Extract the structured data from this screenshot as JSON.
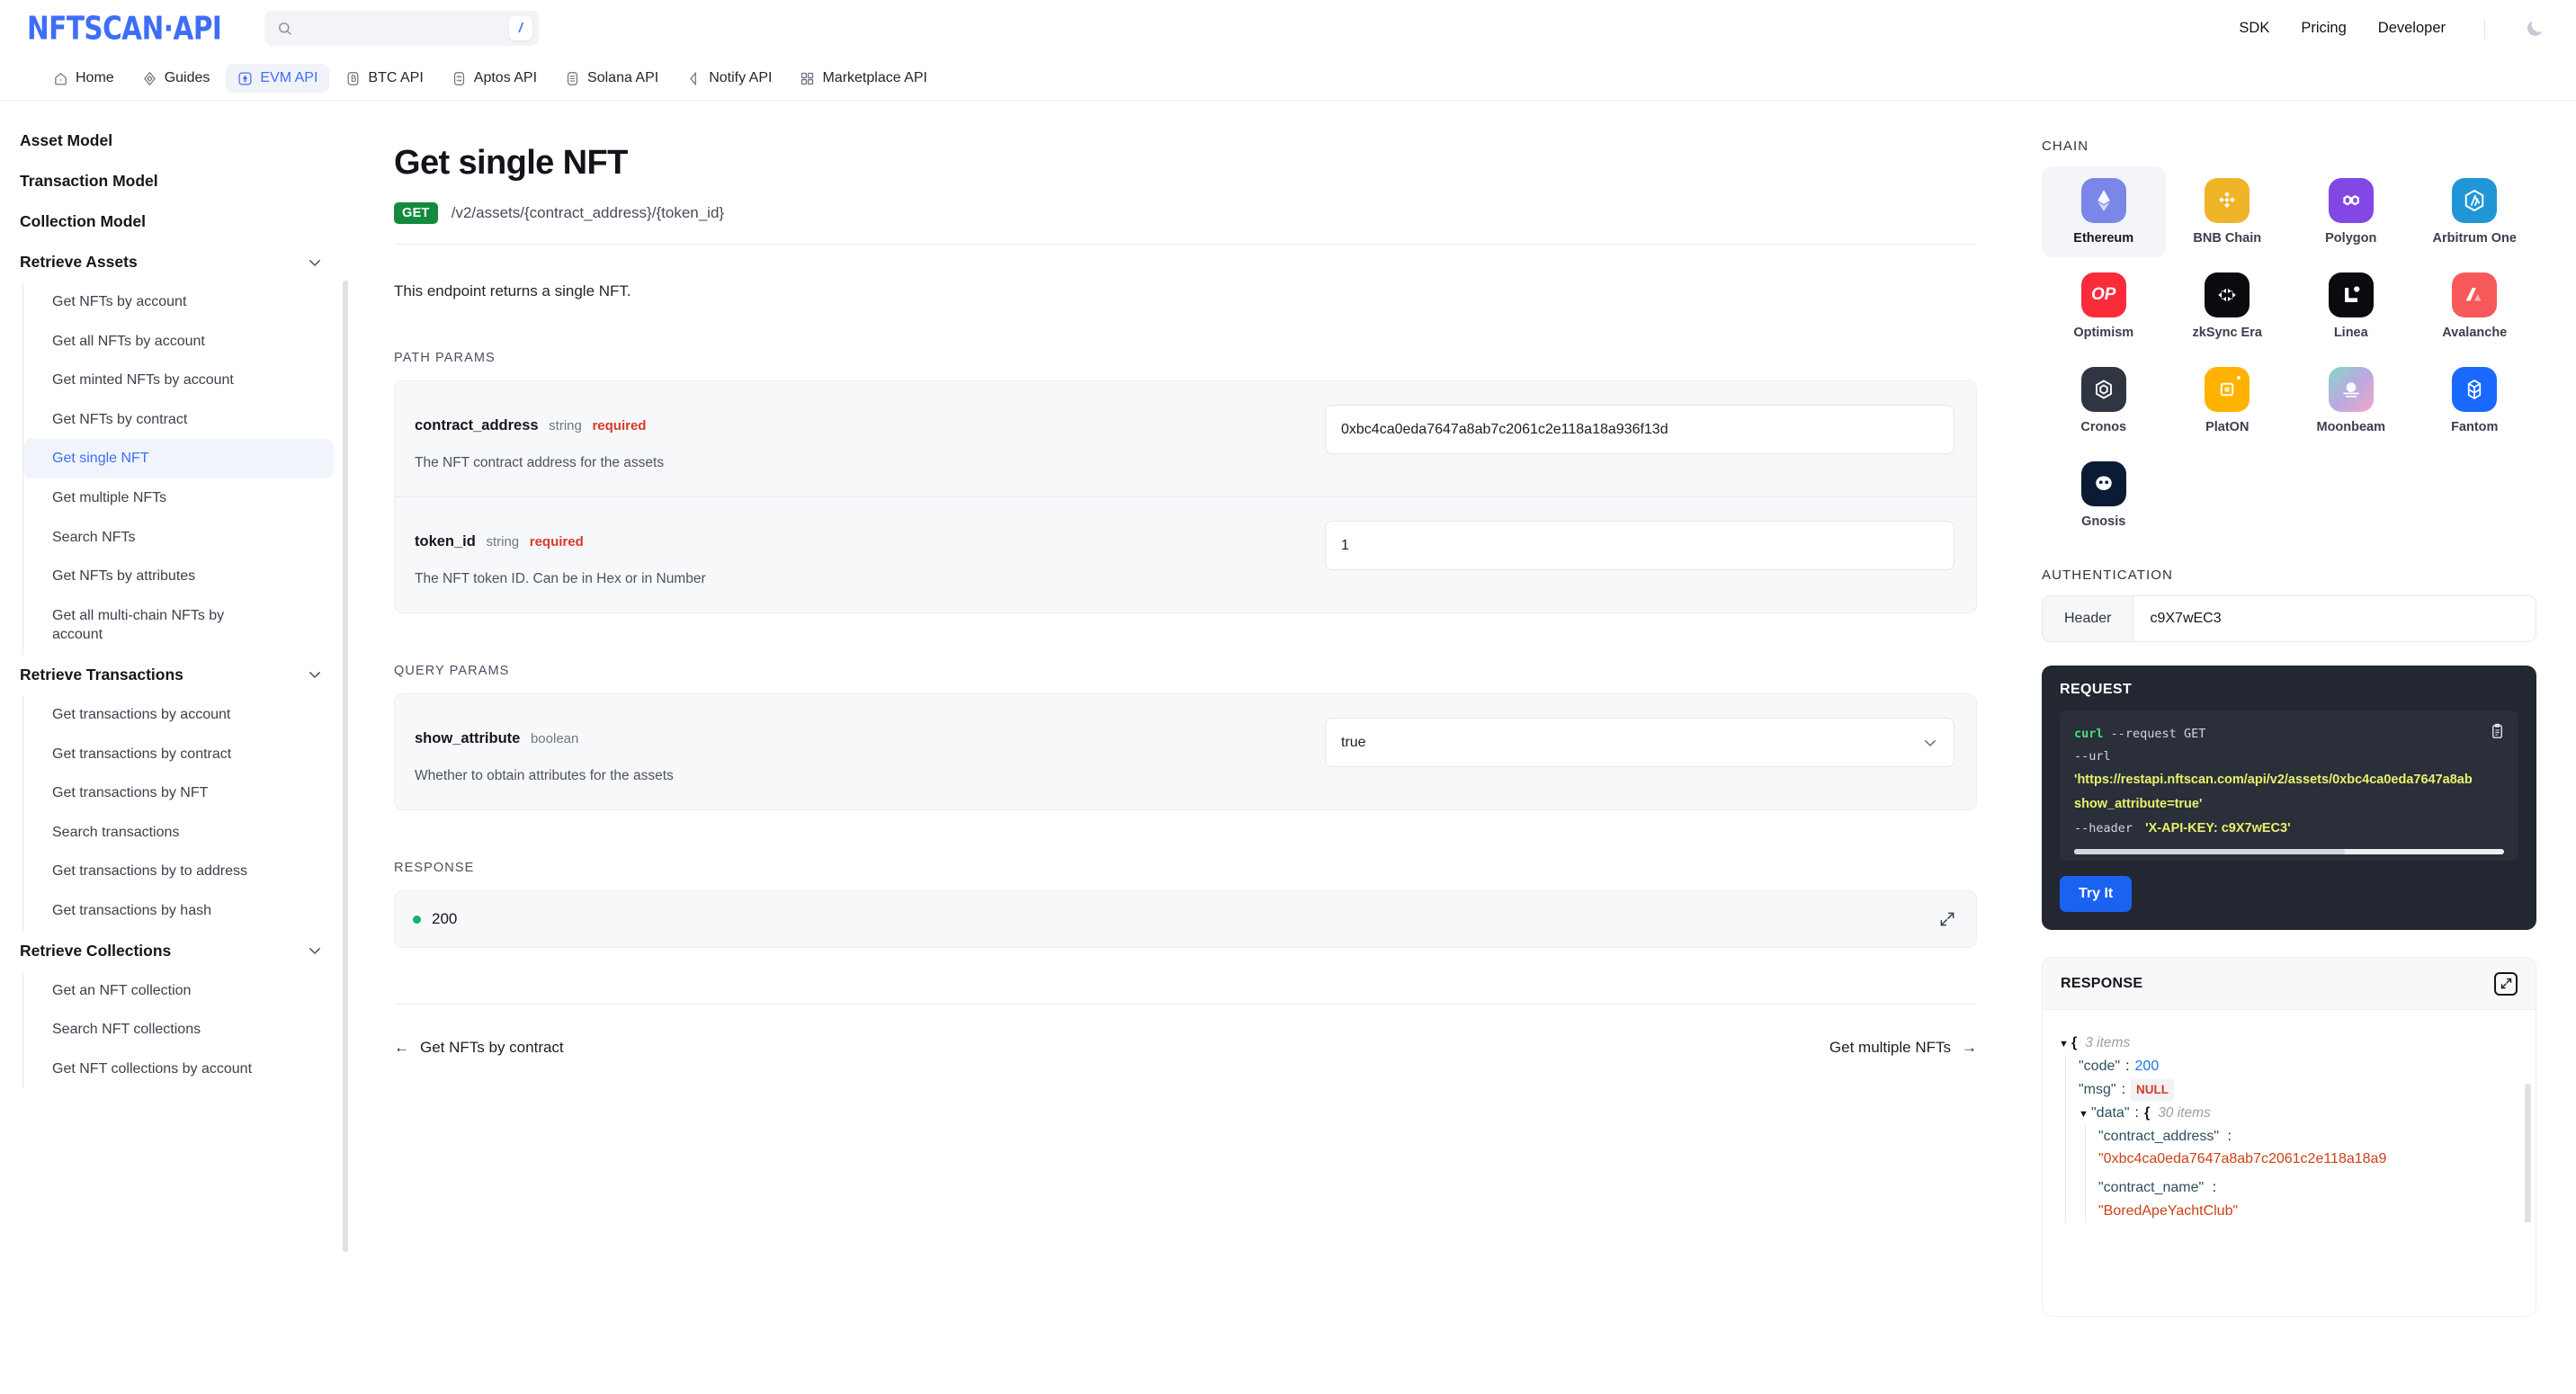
{
  "header": {
    "logo": "NFTSCAN·API",
    "search": {
      "value": "",
      "placeholder": "",
      "shortcut": "/"
    },
    "nav": [
      {
        "label": "SDK"
      },
      {
        "label": "Pricing"
      },
      {
        "label": "Developer"
      }
    ],
    "theme_toggle": "moon-icon"
  },
  "tabs": [
    {
      "label": "Home",
      "icon": "home-icon",
      "active": false
    },
    {
      "label": "Guides",
      "icon": "guides-icon",
      "active": false
    },
    {
      "label": "EVM API",
      "icon": "evm-icon",
      "active": true
    },
    {
      "label": "BTC API",
      "icon": "btc-icon",
      "active": false
    },
    {
      "label": "Aptos API",
      "icon": "aptos-icon",
      "active": false
    },
    {
      "label": "Solana API",
      "icon": "solana-icon",
      "active": false
    },
    {
      "label": "Notify API",
      "icon": "notify-icon",
      "active": false
    },
    {
      "label": "Marketplace API",
      "icon": "marketplace-icon",
      "active": false
    }
  ],
  "sidebar": {
    "groups": [
      {
        "title": "Asset Model",
        "collapsible": false,
        "items": []
      },
      {
        "title": "Transaction Model",
        "collapsible": false,
        "items": []
      },
      {
        "title": "Collection Model",
        "collapsible": false,
        "items": []
      },
      {
        "title": "Retrieve Assets",
        "collapsible": true,
        "items": [
          {
            "label": "Get NFTs by account",
            "active": false
          },
          {
            "label": "Get all NFTs by account",
            "active": false
          },
          {
            "label": "Get minted NFTs by account",
            "active": false
          },
          {
            "label": "Get NFTs by contract",
            "active": false
          },
          {
            "label": "Get single NFT",
            "active": true
          },
          {
            "label": "Get multiple NFTs",
            "active": false
          },
          {
            "label": "Search NFTs",
            "active": false
          },
          {
            "label": "Get NFTs by attributes",
            "active": false
          },
          {
            "label": "Get all multi-chain NFTs by account",
            "active": false
          }
        ]
      },
      {
        "title": "Retrieve Transactions",
        "collapsible": true,
        "items": [
          {
            "label": "Get transactions by account",
            "active": false
          },
          {
            "label": "Get transactions by contract",
            "active": false
          },
          {
            "label": "Get transactions by NFT",
            "active": false
          },
          {
            "label": "Search transactions",
            "active": false
          },
          {
            "label": "Get transactions by to address",
            "active": false
          },
          {
            "label": "Get transactions by hash",
            "active": false
          }
        ]
      },
      {
        "title": "Retrieve Collections",
        "collapsible": true,
        "items": [
          {
            "label": "Get an NFT collection",
            "active": false
          },
          {
            "label": "Search NFT collections",
            "active": false
          },
          {
            "label": "Get NFT collections by account",
            "active": false
          }
        ]
      }
    ]
  },
  "main": {
    "title": "Get single NFT",
    "method": "GET",
    "path": "/v2/assets/{contract_address}/{token_id}",
    "description": "This endpoint returns a single NFT.",
    "path_params_label": "PATH PARAMS",
    "path_params": [
      {
        "name": "contract_address",
        "type": "string",
        "required": "required",
        "description": "The NFT contract address for the assets",
        "value": "0xbc4ca0eda7647a8ab7c2061c2e118a18a936f13d",
        "control": "text"
      },
      {
        "name": "token_id",
        "type": "string",
        "required": "required",
        "description": "The NFT token ID. Can be in Hex or in Number",
        "value": "1",
        "control": "text"
      }
    ],
    "query_params_label": "QUERY PARAMS",
    "query_params": [
      {
        "name": "show_attribute",
        "type": "boolean",
        "required": "",
        "description": "Whether to obtain attributes for the assets",
        "value": "true",
        "control": "select",
        "options": [
          "true",
          "false"
        ]
      }
    ],
    "response_label": "RESPONSE",
    "response_status": "200",
    "response_status_color": "#17b26a",
    "pager": {
      "prev_arrow": "←",
      "prev": "Get NFTs by contract",
      "next": "Get multiple NFTs",
      "next_arrow": "→"
    }
  },
  "rightpanel": {
    "chain_label": "CHAIN",
    "chains": [
      {
        "name": "Ethereum",
        "icon": "ethereum-icon",
        "active": true
      },
      {
        "name": "BNB Chain",
        "icon": "bnb-icon",
        "active": false
      },
      {
        "name": "Polygon",
        "icon": "polygon-icon",
        "active": false
      },
      {
        "name": "Arbitrum One",
        "icon": "arbitrum-icon",
        "active": false
      },
      {
        "name": "Optimism",
        "icon": "optimism-icon",
        "active": false
      },
      {
        "name": "zkSync Era",
        "icon": "zksync-icon",
        "active": false
      },
      {
        "name": "Linea",
        "icon": "linea-icon",
        "active": false
      },
      {
        "name": "Avalanche",
        "icon": "avalanche-icon",
        "active": false
      },
      {
        "name": "Cronos",
        "icon": "cronos-icon",
        "active": false
      },
      {
        "name": "PlatON",
        "icon": "platon-icon",
        "active": false
      },
      {
        "name": "Moonbeam",
        "icon": "moonbeam-icon",
        "active": false
      },
      {
        "name": "Fantom",
        "icon": "fantom-icon",
        "active": false
      },
      {
        "name": "Gnosis",
        "icon": "gnosis-icon",
        "active": false
      }
    ],
    "auth_label": "AUTHENTICATION",
    "auth_tag": "Header",
    "auth_value": "c9X7wEC3",
    "request": {
      "title": "REQUEST",
      "line1_cmd": "curl",
      "line1_flag": "--request",
      "line1_method": "GET",
      "line2_flag": "--url",
      "line3_url": "'https://restapi.nftscan.com/api/v2/assets/0xbc4ca0eda7647a8ab",
      "line4_url": "show_attribute=true'",
      "line5_flag": "--header",
      "line5_val": "'X-API-KEY: c9X7wEC3'",
      "copy_icon": "clipboard-icon",
      "try_label": "Try It"
    },
    "response": {
      "title": "RESPONSE",
      "expand_icon": "expand-icon",
      "root_items": "3 items",
      "code_key": "\"code\"",
      "code_value": "200",
      "msg_key": "\"msg\"",
      "msg_value": "NULL",
      "data_key": "\"data\"",
      "data_items": "30 items",
      "f1_key": "\"contract_address\"",
      "f1_value": "\"0xbc4ca0eda7647a8ab7c2061c2e118a18a9",
      "f2_key": "\"contract_name\"",
      "f2_value": "\"BoredApeYachtClub\""
    }
  },
  "colors": {
    "brand": "#3d6ef7",
    "get_badge": "#138a3c",
    "status_ok": "#17b26a",
    "required": "#d8392b",
    "try_button": "#1a62f0"
  }
}
